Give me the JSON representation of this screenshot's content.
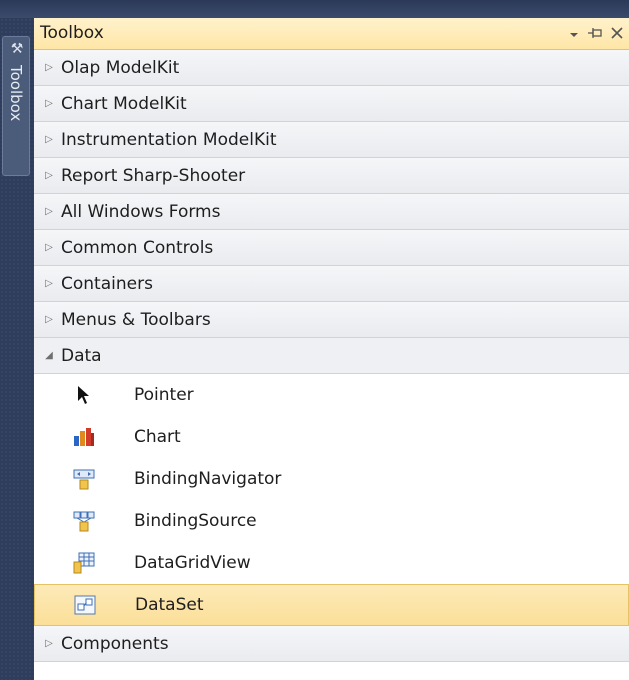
{
  "window": {
    "title": "Toolbox",
    "side_tab_label": "Toolbox",
    "controls": {
      "dropdown_icon": "chevron-down-icon",
      "pin_icon": "pin-icon",
      "close_icon": "close-icon"
    }
  },
  "categories_top": [
    {
      "label": "Olap ModelKit",
      "expanded": false
    },
    {
      "label": "Chart ModelKit",
      "expanded": false
    },
    {
      "label": "Instrumentation ModelKit",
      "expanded": false
    },
    {
      "label": "Report Sharp-Shooter",
      "expanded": false
    },
    {
      "label": "All Windows Forms",
      "expanded": false
    },
    {
      "label": "Common Controls",
      "expanded": false
    },
    {
      "label": "Containers",
      "expanded": false
    },
    {
      "label": "Menus & Toolbars",
      "expanded": false
    }
  ],
  "open_category": {
    "label": "Data",
    "expanded": true
  },
  "tools": [
    {
      "label": "Pointer",
      "icon": "pointer-icon"
    },
    {
      "label": "Chart",
      "icon": "chart-icon"
    },
    {
      "label": "BindingNavigator",
      "icon": "binding-navigator-icon"
    },
    {
      "label": "BindingSource",
      "icon": "binding-source-icon"
    },
    {
      "label": "DataGridView",
      "icon": "datagridview-icon"
    },
    {
      "label": "DataSet",
      "icon": "dataset-icon",
      "selected": true
    }
  ],
  "categories_bottom": [
    {
      "label": "Components",
      "expanded": false
    }
  ],
  "colors": {
    "title_bar": "#ffe6a6",
    "selection": "#fbdf99",
    "side_bar": "#2e3d5c"
  }
}
